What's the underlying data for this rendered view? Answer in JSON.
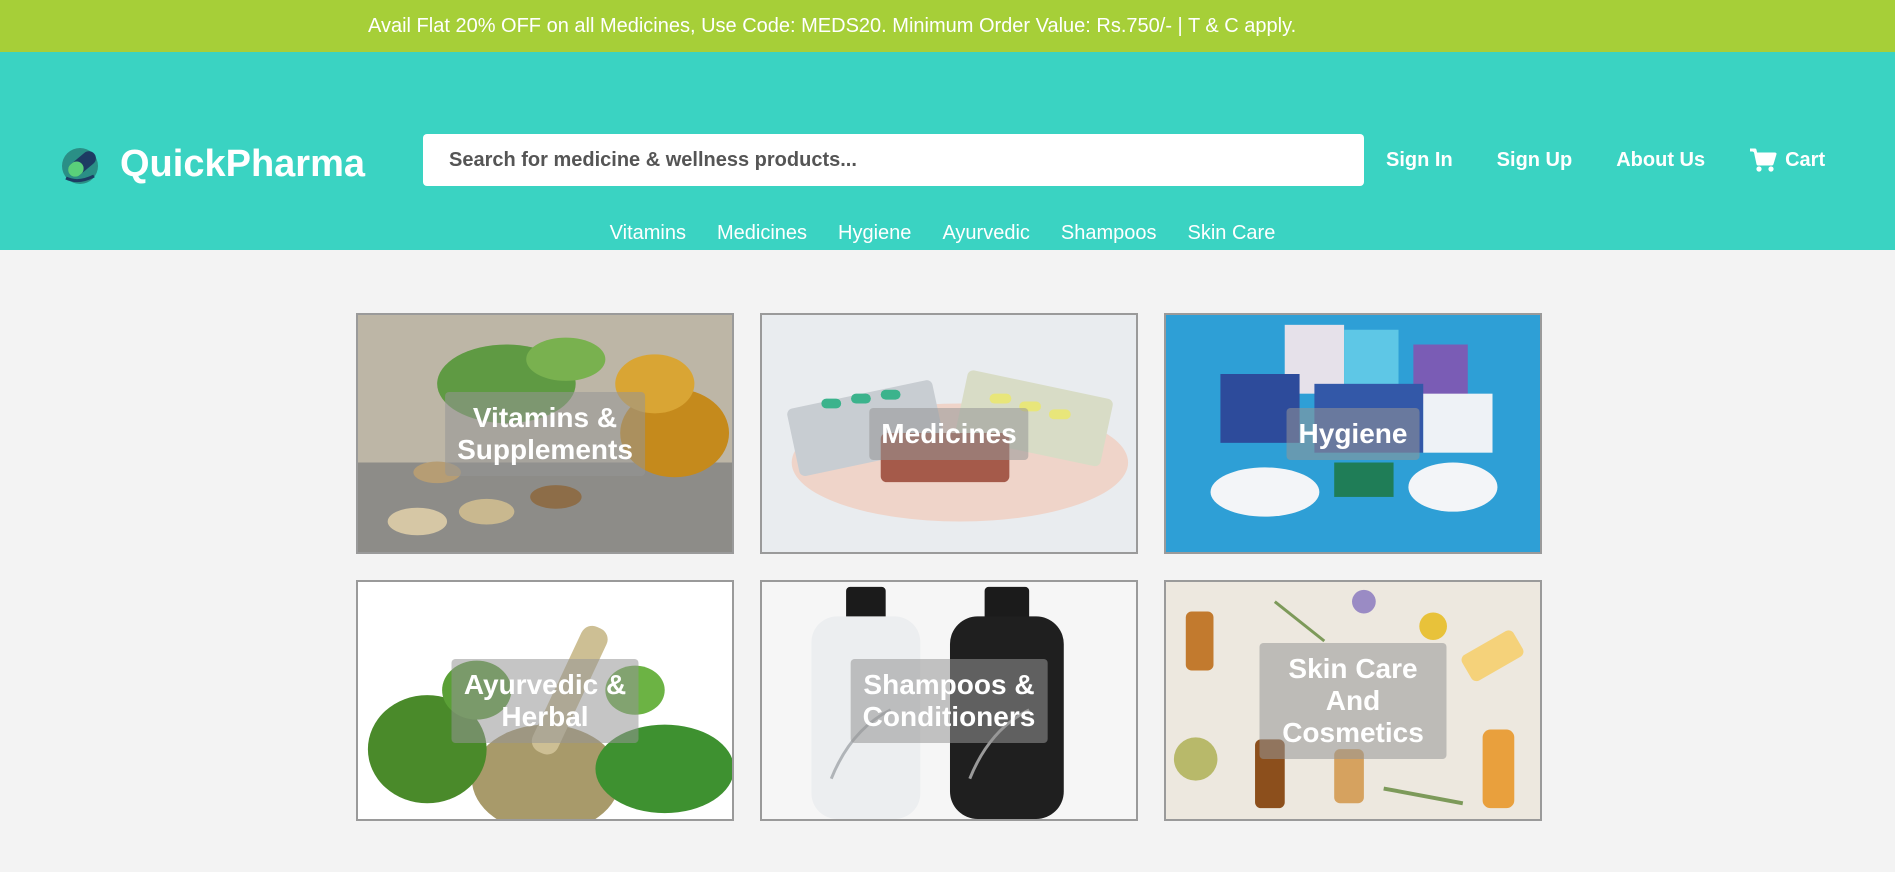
{
  "promo": {
    "text": "Avail Flat 20% OFF on all Medicines, Use Code: MEDS20. Minimum Order Value: Rs.750/- | T & C apply."
  },
  "brand": {
    "name": "QuickPharma",
    "icon": "pill-capsule-logo-icon"
  },
  "search": {
    "placeholder": "Search for medicine & wellness products..."
  },
  "nav": {
    "sign_in": "Sign In",
    "sign_up": "Sign Up",
    "about": "About Us",
    "cart": "Cart"
  },
  "categories": [
    "Vitamins",
    "Medicines",
    "Hygiene",
    "Ayurvedic",
    "Shampoos",
    "Skin Care"
  ],
  "tiles": [
    {
      "label": "Vitamins &\nSupplements"
    },
    {
      "label": "Medicines"
    },
    {
      "label": "Hygiene"
    },
    {
      "label": "Ayurvedic & Herbal"
    },
    {
      "label": "Shampoos &\nConditioners"
    },
    {
      "label": "Skin Care And\nCosmetics"
    }
  ],
  "colors": {
    "promo_bg": "#a6cf38",
    "header_bg": "#3ad3c2",
    "page_bg": "#f3f3f3"
  }
}
